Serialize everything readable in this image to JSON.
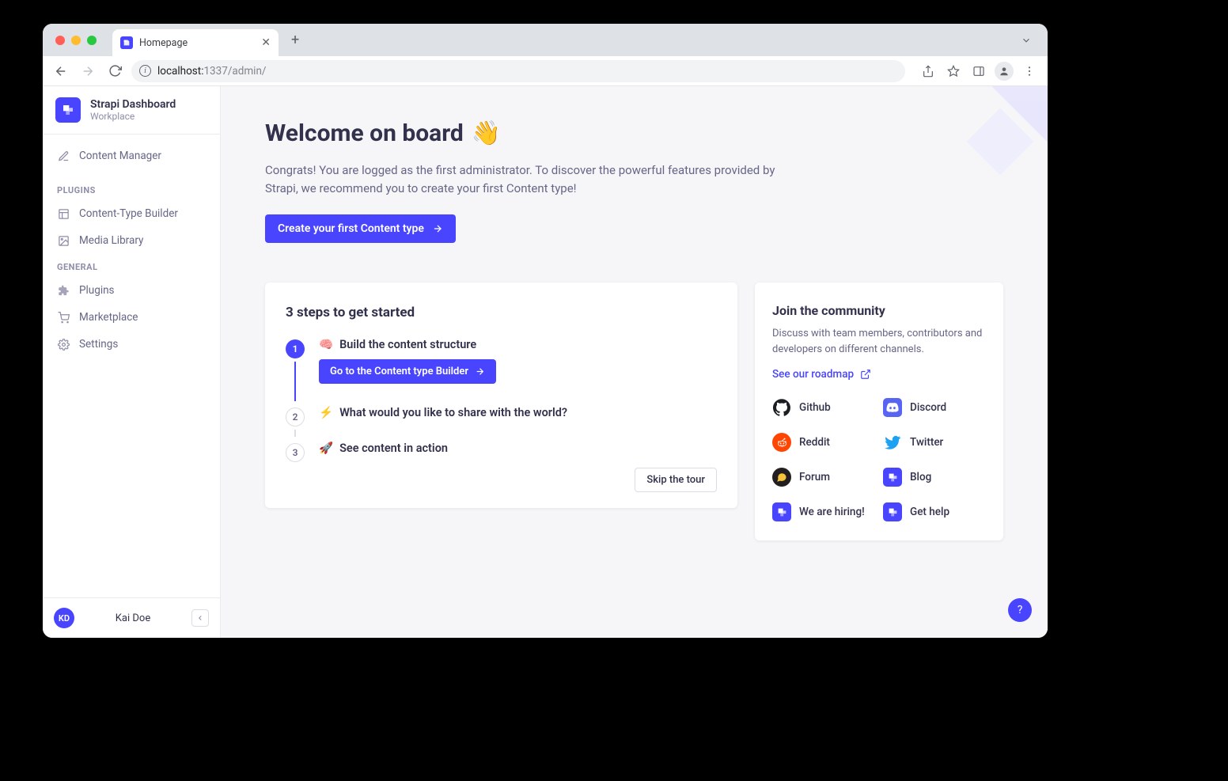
{
  "browser": {
    "tab_title": "Homepage",
    "url_host": "localhost:",
    "url_port_path": "1337/admin/"
  },
  "app": {
    "title": "Strapi Dashboard",
    "subtitle": "Workplace"
  },
  "nav": {
    "top": [
      {
        "label": "Content Manager"
      }
    ],
    "plugins_label": "PLUGINS",
    "plugins": [
      {
        "label": "Content-Type Builder"
      },
      {
        "label": "Media Library"
      }
    ],
    "general_label": "GENERAL",
    "general": [
      {
        "label": "Plugins"
      },
      {
        "label": "Marketplace"
      },
      {
        "label": "Settings"
      }
    ]
  },
  "user": {
    "initials": "KD",
    "name": "Kai Doe"
  },
  "welcome": {
    "title": "Welcome on board",
    "emoji": "👋",
    "subtitle": "Congrats! You are logged as the first administrator. To discover the powerful features provided by Strapi, we recommend you to create your first Content type!",
    "cta": "Create your first Content type"
  },
  "steps": {
    "title": "3 steps to get started",
    "items": [
      {
        "num": "1",
        "emoji": "🧠",
        "label": "Build the content structure",
        "action": "Go to the Content type Builder",
        "active": true
      },
      {
        "num": "2",
        "emoji": "⚡",
        "label": "What would you like to share with the world?",
        "active": false
      },
      {
        "num": "3",
        "emoji": "🚀",
        "label": "See content in action",
        "active": false
      }
    ],
    "skip": "Skip the tour"
  },
  "community": {
    "title": "Join the community",
    "subtitle": "Discuss with team members, contributors and developers on different channels.",
    "roadmap": "See our roadmap",
    "links": [
      {
        "label": "Github",
        "icon": "github"
      },
      {
        "label": "Discord",
        "icon": "discord"
      },
      {
        "label": "Reddit",
        "icon": "reddit"
      },
      {
        "label": "Twitter",
        "icon": "twitter"
      },
      {
        "label": "Forum",
        "icon": "forum"
      },
      {
        "label": "Blog",
        "icon": "strapi"
      },
      {
        "label": "We are hiring!",
        "icon": "strapi"
      },
      {
        "label": "Get help",
        "icon": "strapi"
      }
    ]
  },
  "help": "?"
}
